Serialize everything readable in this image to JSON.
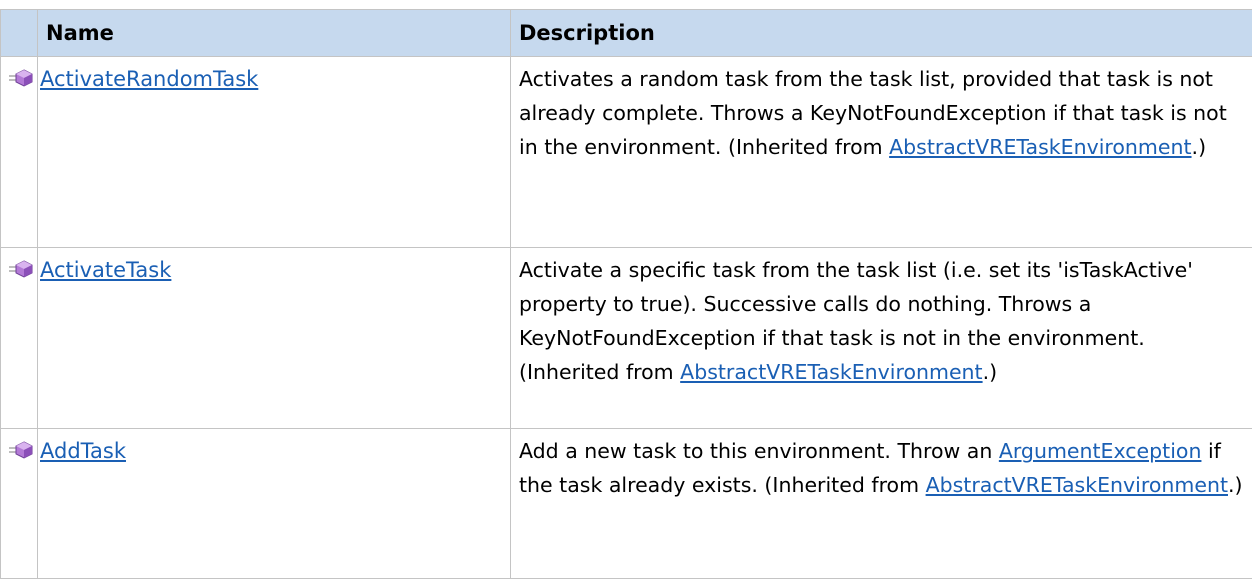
{
  "table": {
    "headers": {
      "icon": "",
      "name": "Name",
      "description": "Description"
    },
    "rows": [
      {
        "icon": "public-method-icon",
        "name": "ActivateRandomTask",
        "desc_before": "Activates a random task from the task list, provided that task is not already complete. Throws a KeyNotFoundException if that task is not in the environment. (Inherited from ",
        "desc_link": "AbstractVRETaskEnvironment",
        "desc_middle": "",
        "desc_link2": "",
        "desc_after": ".)"
      },
      {
        "icon": "public-method-icon",
        "name": "ActivateTask",
        "desc_before": "Activate a specific task from the task list (i.e. set its 'isTaskActive' property to true). Successive calls do nothing. Throws a KeyNotFoundException if that task is not in the environment. (Inherited from ",
        "desc_link": "AbstractVRETaskEnvironment",
        "desc_middle": "",
        "desc_link2": "",
        "desc_after": ".)"
      },
      {
        "icon": "public-method-icon",
        "name": "AddTask",
        "desc_before": "Add a new task to this environment. Throw an ",
        "desc_link": "ArgumentException",
        "desc_middle": " if the task already exists. (Inherited from ",
        "desc_link2": "AbstractVRETaskEnvironment",
        "desc_after": ".)"
      }
    ]
  },
  "colors": {
    "header_bg": "#c6d9ee",
    "link": "#1a5fb4",
    "border": "#c4c4c4",
    "icon_purple": "#9b59c9"
  }
}
